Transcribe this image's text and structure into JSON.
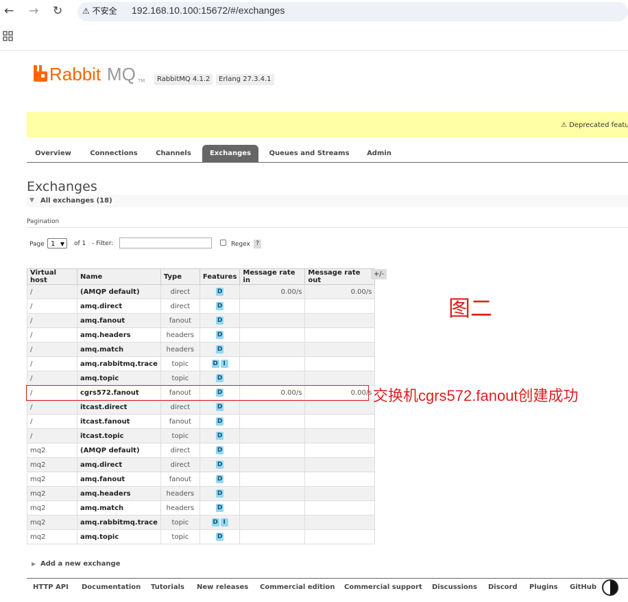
{
  "browser": {
    "back_icon": "←",
    "forward_icon": "→",
    "reload_icon": "↻",
    "security_label": "⚠ 不安全",
    "url": "192.168.10.100:15672/#/exchanges"
  },
  "header": {
    "logo_rabbit": "RabbitMQ",
    "logo_rabbit_a": "Rabbit",
    "logo_rabbit_b": "MQ",
    "logo_tm": "TM",
    "rabbitmq_version": "RabbitMQ 4.1.2",
    "erlang_version": "Erlang 27.3.4.1",
    "brand_color": "#ff6600"
  },
  "warning": {
    "text": "⚠ Deprecated featu"
  },
  "tabs": [
    {
      "label": "Overview",
      "active": false
    },
    {
      "label": "Connections",
      "active": false
    },
    {
      "label": "Channels",
      "active": false
    },
    {
      "label": "Exchanges",
      "active": true
    },
    {
      "label": "Queues and Streams",
      "active": false
    },
    {
      "label": "Admin",
      "active": false
    }
  ],
  "page": {
    "title": "Exchanges",
    "section_label": "All exchanges (18)",
    "pagination_label": "Pagination",
    "page_label": "Page",
    "page_value": "1",
    "of_label": "of 1",
    "filter_label": "- Filter:",
    "filter_value": "",
    "regex_label": "Regex",
    "help_label": "?",
    "plus_minus": "+/-",
    "add_exchange": "Add a new exchange"
  },
  "table": {
    "columns": [
      "Virtual host",
      "Name",
      "Type",
      "Features",
      "Message rate in",
      "Message rate out"
    ],
    "rows": [
      {
        "vhost": "/",
        "name": "(AMQP default)",
        "type": "direct",
        "features": [
          "D"
        ],
        "rate_in": "0.00/s",
        "rate_out": "0.00/s"
      },
      {
        "vhost": "/",
        "name": "amq.direct",
        "type": "direct",
        "features": [
          "D"
        ],
        "rate_in": "",
        "rate_out": ""
      },
      {
        "vhost": "/",
        "name": "amq.fanout",
        "type": "fanout",
        "features": [
          "D"
        ],
        "rate_in": "",
        "rate_out": ""
      },
      {
        "vhost": "/",
        "name": "amq.headers",
        "type": "headers",
        "features": [
          "D"
        ],
        "rate_in": "",
        "rate_out": ""
      },
      {
        "vhost": "/",
        "name": "amq.match",
        "type": "headers",
        "features": [
          "D"
        ],
        "rate_in": "",
        "rate_out": ""
      },
      {
        "vhost": "/",
        "name": "amq.rabbitmq.trace",
        "type": "topic",
        "features": [
          "D",
          "I"
        ],
        "rate_in": "",
        "rate_out": ""
      },
      {
        "vhost": "/",
        "name": "amq.topic",
        "type": "topic",
        "features": [
          "D"
        ],
        "rate_in": "",
        "rate_out": ""
      },
      {
        "vhost": "/",
        "name": "cgrs572.fanout",
        "type": "fanout",
        "features": [
          "D"
        ],
        "rate_in": "0.00/s",
        "rate_out": "0.00/s"
      },
      {
        "vhost": "/",
        "name": "itcast.direct",
        "type": "direct",
        "features": [
          "D"
        ],
        "rate_in": "",
        "rate_out": ""
      },
      {
        "vhost": "/",
        "name": "itcast.fanout",
        "type": "fanout",
        "features": [
          "D"
        ],
        "rate_in": "",
        "rate_out": ""
      },
      {
        "vhost": "/",
        "name": "itcast.topic",
        "type": "topic",
        "features": [
          "D"
        ],
        "rate_in": "",
        "rate_out": ""
      },
      {
        "vhost": "mq2",
        "name": "(AMQP default)",
        "type": "direct",
        "features": [
          "D"
        ],
        "rate_in": "",
        "rate_out": ""
      },
      {
        "vhost": "mq2",
        "name": "amq.direct",
        "type": "direct",
        "features": [
          "D"
        ],
        "rate_in": "",
        "rate_out": ""
      },
      {
        "vhost": "mq2",
        "name": "amq.fanout",
        "type": "fanout",
        "features": [
          "D"
        ],
        "rate_in": "",
        "rate_out": ""
      },
      {
        "vhost": "mq2",
        "name": "amq.headers",
        "type": "headers",
        "features": [
          "D"
        ],
        "rate_in": "",
        "rate_out": ""
      },
      {
        "vhost": "mq2",
        "name": "amq.match",
        "type": "headers",
        "features": [
          "D"
        ],
        "rate_in": "",
        "rate_out": ""
      },
      {
        "vhost": "mq2",
        "name": "amq.rabbitmq.trace",
        "type": "topic",
        "features": [
          "D",
          "I"
        ],
        "rate_in": "",
        "rate_out": ""
      },
      {
        "vhost": "mq2",
        "name": "amq.topic",
        "type": "topic",
        "features": [
          "D"
        ],
        "rate_in": "",
        "rate_out": ""
      }
    ]
  },
  "annotations": {
    "figure_label": "图二",
    "success_label": "交换机cgrs572.fanout创建成功",
    "annotation_color": "#e02020"
  },
  "footer": {
    "links": [
      "HTTP API",
      "Documentation",
      "Tutorials",
      "New releases",
      "Commercial edition",
      "Commercial support",
      "Discussions",
      "Discord",
      "Plugins",
      "GitHub"
    ]
  },
  "icons": {
    "apps": "apps-grid-icon",
    "theme": "theme-toggle-icon",
    "logo": "rabbitmq-logo-icon"
  }
}
